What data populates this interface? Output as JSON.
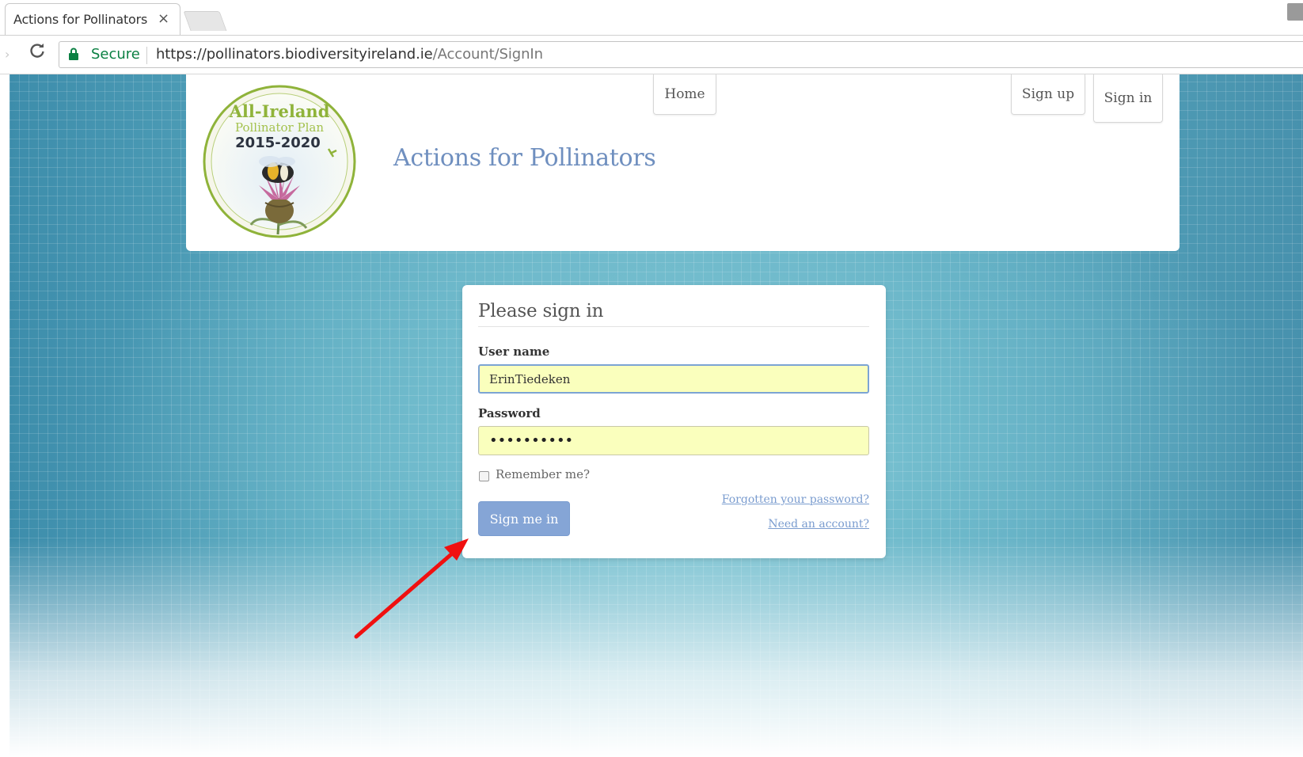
{
  "browser": {
    "tab_title": "Actions for Pollinators",
    "tab_close_glyph": "×",
    "back_icon": "back-arrow-icon",
    "reload_glyph": "C",
    "security_label": "Secure",
    "url_origin": "https://pollinators.biodiversityireland.ie",
    "url_path": "/Account/SignIn"
  },
  "header": {
    "logo": {
      "line1": "All-Ireland",
      "line2": "Pollinator Plan",
      "line3": "2015-2020"
    },
    "site_title": "Actions for Pollinators",
    "nav": {
      "home": "Home",
      "sign_up": "Sign up",
      "sign_in": "Sign in"
    }
  },
  "signin": {
    "heading": "Please sign in",
    "username_label": "User name",
    "username_value": "ErinTiedeken",
    "password_label": "Password",
    "password_mask": "••••••••••",
    "remember_label": "Remember me?",
    "remember_checked": false,
    "submit_label": "Sign me in",
    "forgot_link": "Forgotten your password?",
    "need_account_link": "Need an account?"
  },
  "colors": {
    "title_blue": "#6f8fbf",
    "button_blue": "#85a5d6",
    "autofill_yellow": "#faffbd",
    "secure_green": "#0b8043",
    "annotation_red": "#f01010"
  }
}
